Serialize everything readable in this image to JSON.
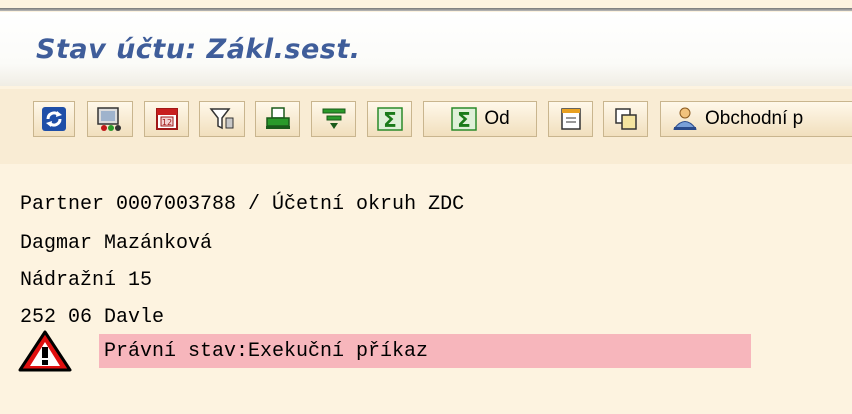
{
  "window": {
    "title": "Stav účtu: Zákl.sest."
  },
  "toolbar": {
    "buttons": [
      {
        "icon": "refresh-icon"
      },
      {
        "icon": "display-layout-icon"
      },
      {
        "icon": "calendar-icon"
      },
      {
        "icon": "filter-icon"
      },
      {
        "icon": "print-icon"
      },
      {
        "icon": "sort-filter-icon"
      },
      {
        "icon": "sum-icon"
      },
      {
        "icon": "subtotal-icon",
        "label": "Od"
      },
      {
        "icon": "document-icon"
      },
      {
        "icon": "copy-icon"
      },
      {
        "icon": "business-partner-icon",
        "label": "Obchodní p"
      }
    ]
  },
  "partner": {
    "header": "Partner 0007003788 / Účetní okruh ZDC",
    "name": "Dagmar Mazánková",
    "street": "Nádražní 15",
    "city": "252 06 Davle",
    "legal_status": "Právní stav:Exekuční příkaz"
  },
  "colors": {
    "title": "#3f5d9a",
    "background": "#fdf3e0",
    "toolbar": "#f9ecd4",
    "legal_status_band": "#f7b6bc",
    "warning_red": "#e01010"
  }
}
